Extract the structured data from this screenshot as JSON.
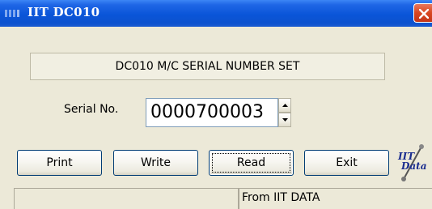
{
  "window": {
    "title": "IIT DC010",
    "titlebar_color": "#0A55D8",
    "close_color": "#D8461F"
  },
  "heading": "DC010 M/C SERIAL NUMBER SET",
  "serial": {
    "label": "Serial No.",
    "value": "0000700003"
  },
  "buttons": {
    "print": "Print",
    "write": "Write",
    "read": "Read",
    "exit": "Exit"
  },
  "logo": {
    "line1": "IIT",
    "line2": "Data"
  },
  "status": {
    "left": "",
    "right": "From IIT DATA"
  }
}
